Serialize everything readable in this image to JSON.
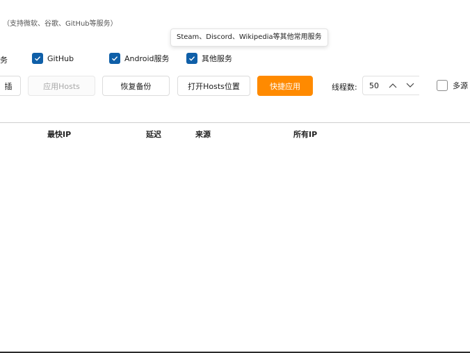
{
  "header": {
    "subtitle": "（支持微软、谷歌、GitHub等服务）"
  },
  "tooltip": {
    "text": "Steam、Discord、Wikipedia等其他常用服务"
  },
  "services": {
    "cutoff_label": "务",
    "items": [
      {
        "label": "GitHub",
        "checked": true
      },
      {
        "label": "Android服务",
        "checked": true
      },
      {
        "label": "其他服务",
        "checked": true
      }
    ]
  },
  "toolbar": {
    "cutoff_btn": "插",
    "apply_hosts": "应用Hosts",
    "restore_backup": "恢复备份",
    "open_hosts": "打开Hosts位置",
    "quick_apply": "快捷应用",
    "thread_label": "线程数:",
    "thread_value": "50",
    "multi_source_label": "多源",
    "multi_source_checked": false
  },
  "table": {
    "columns": [
      "最快IP",
      "延迟",
      "来源",
      "所有IP"
    ],
    "rows": []
  },
  "colors": {
    "checkbox_checked": "#0f5fa8",
    "primary_button": "#ff8a00"
  }
}
